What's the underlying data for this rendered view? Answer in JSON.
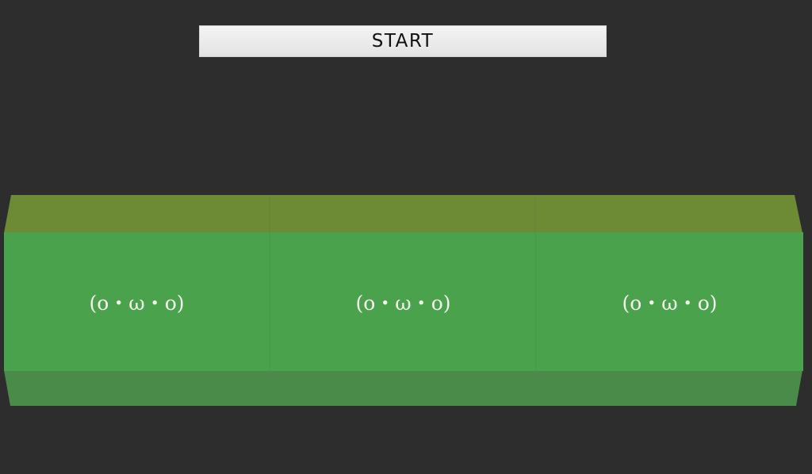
{
  "start_button": {
    "label": "START"
  },
  "reels": [
    {
      "face": "(o・ω・o)"
    },
    {
      "face": "(o・ω・o)"
    },
    {
      "face": "(o・ω・o)"
    }
  ],
  "colors": {
    "background": "#2d2d2d",
    "reel_top": "#6d8a35",
    "reel_front": "#4aa24c",
    "reel_bottom": "#4a8b4a",
    "face_text": "#f2f6ee"
  }
}
